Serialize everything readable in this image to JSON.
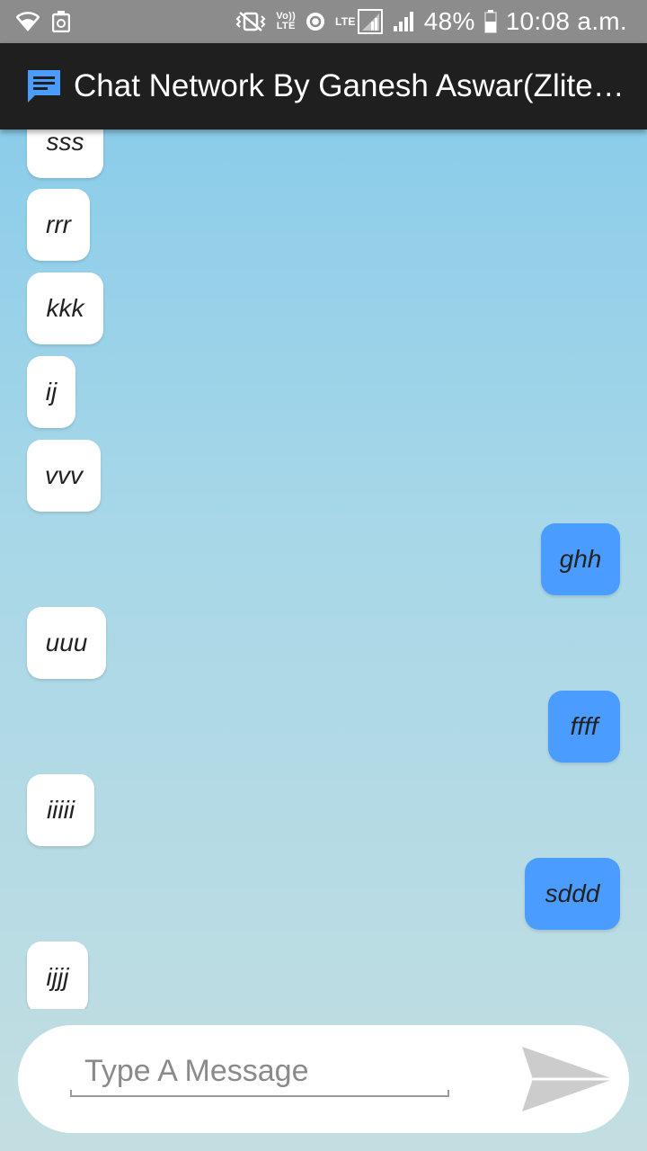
{
  "status_bar": {
    "battery": "48%",
    "time": "10:08 a.m.",
    "volte_top": "Vo))",
    "volte_bottom": "LTE",
    "lte": "LTE",
    "icons": [
      "wifi-icon",
      "recycle-notification-icon",
      "vibrate-icon",
      "volte-icon",
      "data-sync-icon",
      "lte-signal-icon",
      "cell-signal-icon",
      "battery-icon"
    ]
  },
  "app_bar": {
    "title": "Chat Network By Ganesh Aswar(Zlite…",
    "icon": "chat-bubble-icon"
  },
  "messages": [
    {
      "text": "sss",
      "side": "left"
    },
    {
      "text": "rrr",
      "side": "left"
    },
    {
      "text": "kkk",
      "side": "left"
    },
    {
      "text": "ij",
      "side": "left"
    },
    {
      "text": "vvv",
      "side": "left"
    },
    {
      "text": "ghh",
      "side": "right"
    },
    {
      "text": "uuu",
      "side": "left"
    },
    {
      "text": "ffff",
      "side": "right"
    },
    {
      "text": "iiiii",
      "side": "left"
    },
    {
      "text": "sddd",
      "side": "right"
    },
    {
      "text": "ijjj",
      "side": "left"
    }
  ],
  "composer": {
    "placeholder": "Type A Message",
    "value": "",
    "send_icon": "send-icon"
  },
  "colors": {
    "sent_bubble": "#4a9cff",
    "received_bubble": "#ffffff",
    "app_bar": "#1f1f1f",
    "status_bar": "#8c8c8c"
  }
}
